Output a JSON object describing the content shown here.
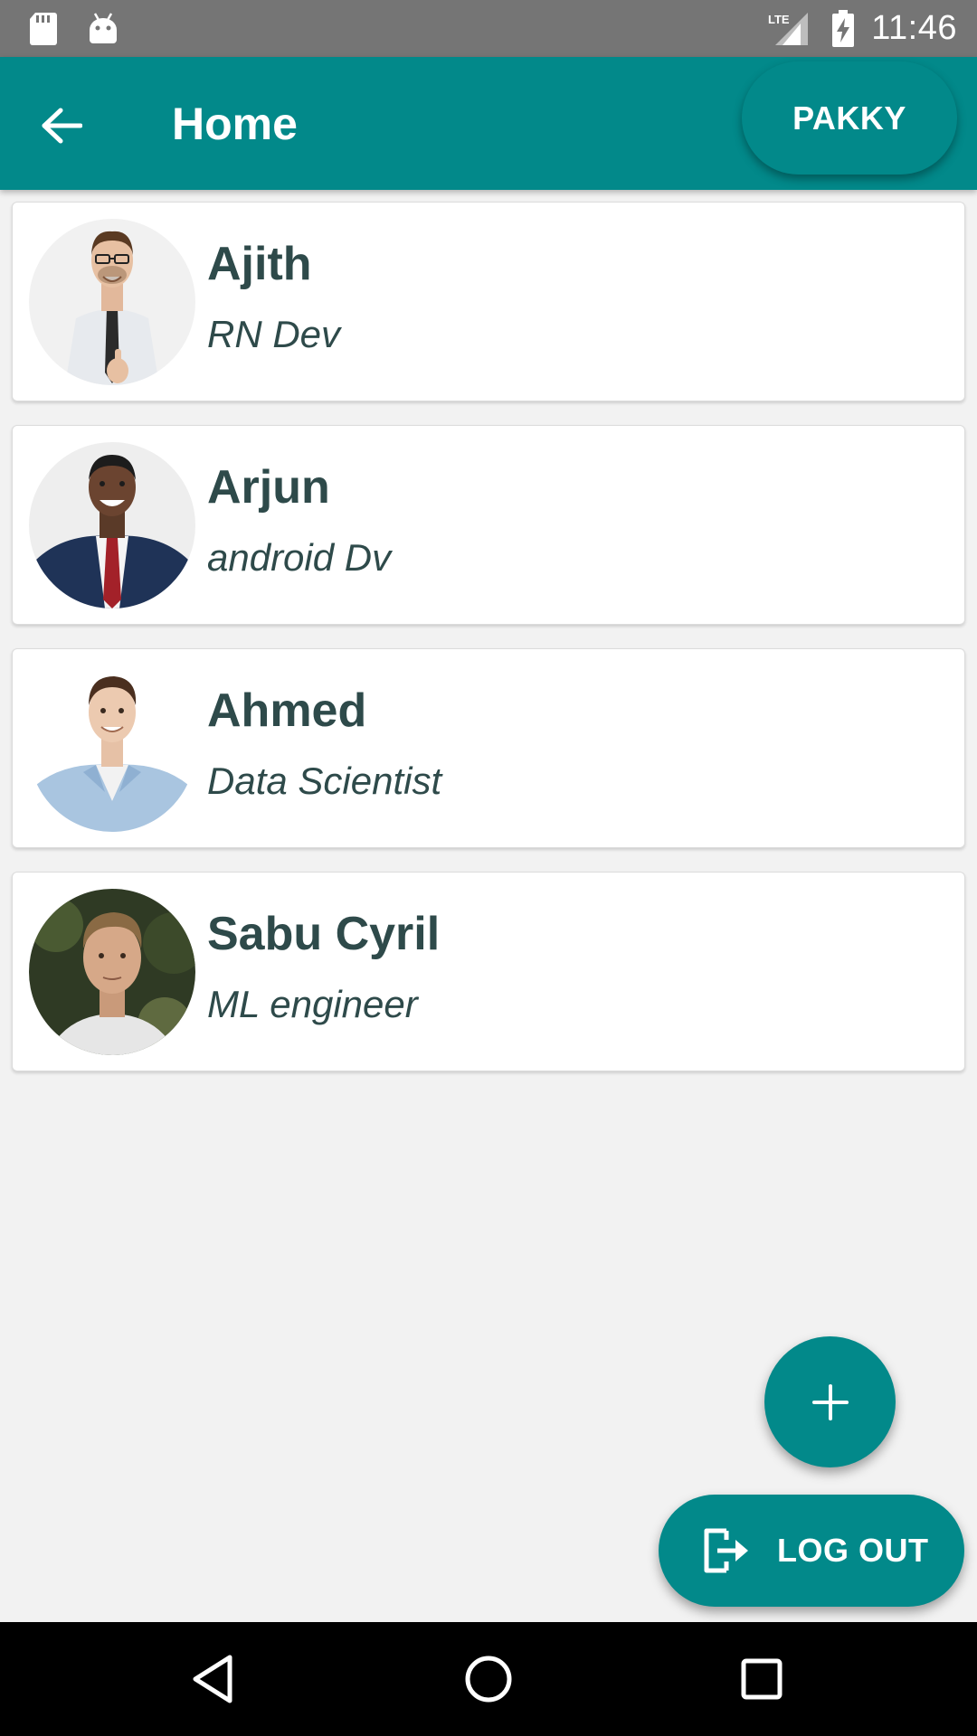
{
  "status_bar": {
    "time": "11:46",
    "network": "LTE",
    "left_icons": [
      "sd-card-icon",
      "android-icon"
    ],
    "right_icons": [
      "lte-signal-icon",
      "battery-charging-icon"
    ]
  },
  "app_bar": {
    "title": "Home",
    "back_icon": "arrow-left-icon",
    "action_label": "PAKKY"
  },
  "people": [
    {
      "name": "Ajith",
      "role": "RN Dev",
      "avatar": "avatar-photo-man-in-tie-thumbs-up"
    },
    {
      "name": "Arjun",
      "role": "android Dv",
      "avatar": "avatar-photo-man-in-suit"
    },
    {
      "name": "Ahmed",
      "role": "Data Scientist",
      "avatar": "avatar-photo-man-in-denim-shirt"
    },
    {
      "name": "Sabu Cyril",
      "role": "ML engineer",
      "avatar": "avatar-photo-man-outdoors"
    }
  ],
  "fab": {
    "icon": "plus-icon"
  },
  "logout": {
    "label": "LOG OUT",
    "icon": "logout-icon"
  },
  "nav_bar": {
    "icons": [
      "nav-back-icon",
      "nav-home-icon",
      "nav-recents-icon"
    ]
  },
  "colors": {
    "primary": "#02898a",
    "status_bar": "#757575",
    "background": "#f2f2f2",
    "card_text": "#2e4a4a"
  }
}
